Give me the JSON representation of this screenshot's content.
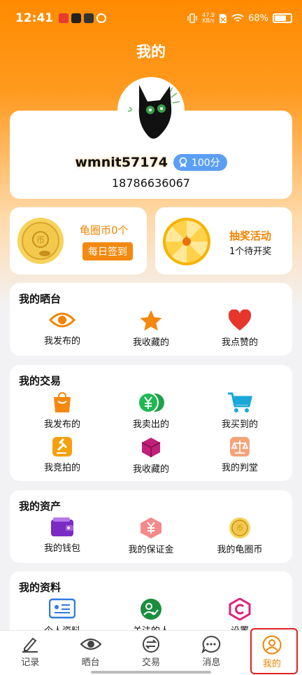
{
  "status_bar": {
    "time": "12:41",
    "speed_value": "47.9",
    "speed_unit": "KB/s",
    "battery": "68%",
    "battery_level": 0.68
  },
  "header": {
    "title": "我的"
  },
  "profile": {
    "username": "wmnit57174",
    "score": "100分",
    "phone": "18786636067"
  },
  "coins": {
    "label": "龟圈币0个",
    "sign_button": "每日签到"
  },
  "lottery": {
    "title": "抽奖活动",
    "subtitle": "1个待开奖"
  },
  "showcase": {
    "title": "我的晒台",
    "items": [
      {
        "label": "我发布的",
        "icon": "eye-icon"
      },
      {
        "label": "我收藏的",
        "icon": "star-icon"
      },
      {
        "label": "我点赞的",
        "icon": "heart-icon"
      }
    ]
  },
  "trade": {
    "title": "我的交易",
    "items": [
      {
        "label": "我发布的",
        "icon": "shopping-bag-icon"
      },
      {
        "label": "我卖出的",
        "icon": "yen-coin-icon"
      },
      {
        "label": "我买到的",
        "icon": "cart-icon"
      },
      {
        "label": "我竞拍的",
        "icon": "auction-hammer-icon"
      },
      {
        "label": "我收藏的",
        "icon": "box-icon"
      },
      {
        "label": "我的判堂",
        "icon": "scales-icon"
      }
    ]
  },
  "assets": {
    "title": "我的资产",
    "items": [
      {
        "label": "我的钱包",
        "icon": "wallet-icon"
      },
      {
        "label": "我的保证金",
        "icon": "deposit-icon"
      },
      {
        "label": "我的龟圈币",
        "icon": "coin-icon"
      }
    ]
  },
  "info": {
    "title": "我的资料",
    "items": [
      {
        "label": "个人资料",
        "icon": "profile-card-icon"
      },
      {
        "label": "关注的人",
        "icon": "follow-icon"
      },
      {
        "label": "设置",
        "icon": "settings-icon"
      }
    ]
  },
  "bottom_nav": {
    "items": [
      {
        "label": "记录",
        "icon": "pen-icon"
      },
      {
        "label": "晒台",
        "icon": "eye-icon"
      },
      {
        "label": "交易",
        "icon": "exchange-icon"
      },
      {
        "label": "消息",
        "icon": "chat-icon"
      },
      {
        "label": "我的",
        "icon": "person-icon",
        "active": true
      }
    ]
  },
  "colors": {
    "accent": "#f08400",
    "header": "#ff8a00",
    "badge": "#5b9ff5",
    "highlight_frame": "#e02020"
  }
}
